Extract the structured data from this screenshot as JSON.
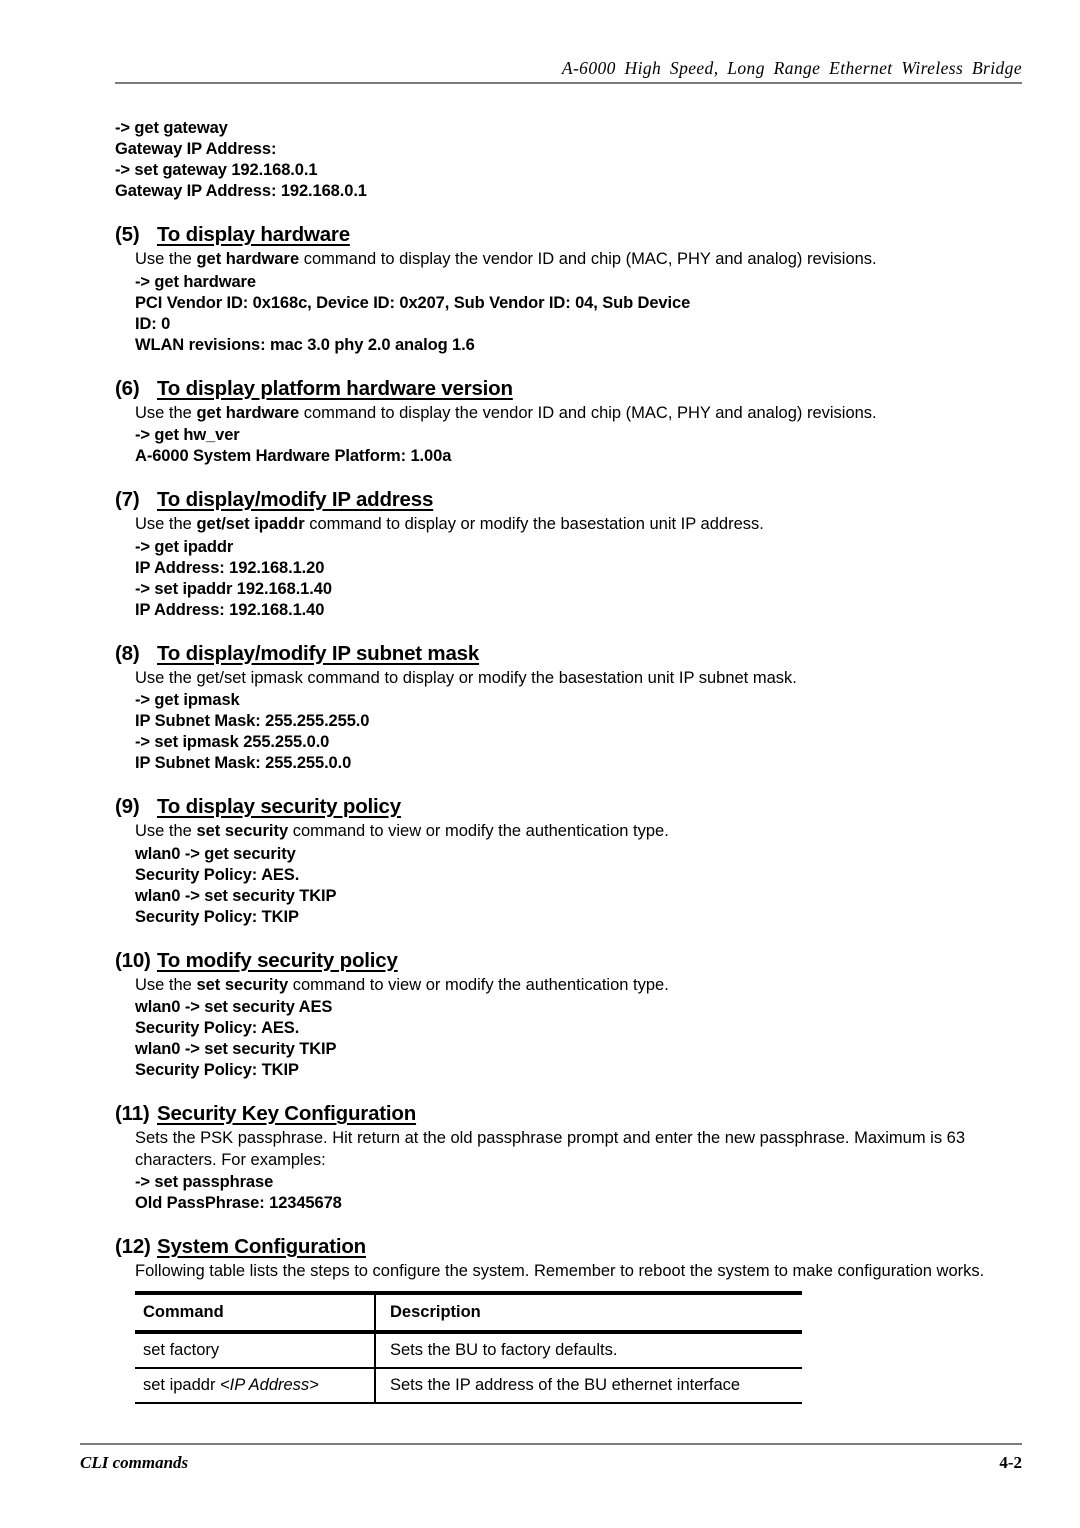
{
  "header": {
    "running_title": "A-6000 High Speed, Long Range Ethernet Wireless Bridge"
  },
  "top_cli": {
    "lines": [
      "-> get gateway",
      "Gateway IP Address:",
      "-> set gateway 192.168.0.1",
      "Gateway IP Address: 192.168.0.1"
    ]
  },
  "sections": [
    {
      "number": "(5)",
      "title": "To display hardware",
      "desc_pre": "Use the ",
      "desc_bold": "get hardware",
      "desc_post": " command to display the vendor ID and chip (MAC, PHY and analog) revisions.",
      "cli": [
        "-> get hardware",
        "PCI Vendor ID: 0x168c, Device ID: 0x207, Sub Vendor ID: 04, Sub Device",
        "ID: 0",
        "WLAN revisions: mac 3.0 phy 2.0 analog 1.6"
      ]
    },
    {
      "number": "(6)",
      "title": "To display platform hardware version",
      "desc_pre": "Use the ",
      "desc_bold": "get hardware",
      "desc_post": " command to display the vendor ID and chip (MAC, PHY and analog) revisions.",
      "cli": [
        "-> get hw_ver",
        "A-6000 System Hardware Platform: 1.00a"
      ]
    },
    {
      "number": "(7)",
      "title": "To display/modify IP address",
      "desc_pre": "Use the ",
      "desc_bold": "get/set ipaddr",
      "desc_post": " command to display or modify the basestation unit IP address.",
      "cli": [
        "-> get ipaddr",
        "IP Address: 192.168.1.20",
        "-> set ipaddr 192.168.1.40",
        "IP Address: 192.168.1.40"
      ]
    },
    {
      "number": "(8)",
      "title": "To display/modify IP subnet mask",
      "desc_pre": "Use the get/set ipmask command to display or modify the basestation unit IP subnet mask.",
      "desc_bold": "",
      "desc_post": "",
      "cli": [
        "-> get ipmask",
        "IP Subnet Mask: 255.255.255.0",
        "-> set ipmask 255.255.0.0",
        "IP Subnet Mask: 255.255.0.0"
      ]
    },
    {
      "number": "(9)",
      "title": "To display security policy",
      "desc_pre": "Use the ",
      "desc_bold": "set security",
      "desc_post": " command to view or modify the authentication type.",
      "cli": [
        "wlan0 -> get security",
        "Security Policy: AES.",
        "wlan0 -> set security TKIP",
        "Security Policy: TKIP"
      ]
    },
    {
      "number": "(10)",
      "title": "To modify security policy",
      "desc_pre": "Use the ",
      "desc_bold": "set security",
      "desc_post": " command to view or modify the authentication type.",
      "cli": [
        "wlan0 -> set security AES",
        "Security Policy: AES.",
        "wlan0 -> set security TKIP",
        "Security Policy: TKIP"
      ]
    },
    {
      "number": "(11)",
      "title": "Security Key Configuration",
      "desc_pre": "Sets the PSK passphrase. Hit return at the old passphrase prompt and enter the new passphrase. Maximum is 63 characters. For examples:",
      "desc_bold": "",
      "desc_post": "",
      "cli": [
        "-> set passphrase",
        "Old PassPhrase: 12345678"
      ]
    },
    {
      "number": "(12)",
      "title": "System Configuration",
      "desc_pre": "Following table lists the steps to configure the system. Remember to reboot the system to make configuration works.",
      "desc_bold": "",
      "desc_post": "",
      "cli": []
    }
  ],
  "table": {
    "columns": [
      "Command",
      "Description"
    ],
    "rows": [
      {
        "command": "set factory",
        "command_italic": "",
        "description": "Sets the BU to factory defaults."
      },
      {
        "command": "set ipaddr ",
        "command_italic": "<IP Address>",
        "description": "Sets the IP address of the BU ethernet interface"
      }
    ]
  },
  "footer": {
    "left": "CLI commands",
    "page_number": "4-2"
  }
}
